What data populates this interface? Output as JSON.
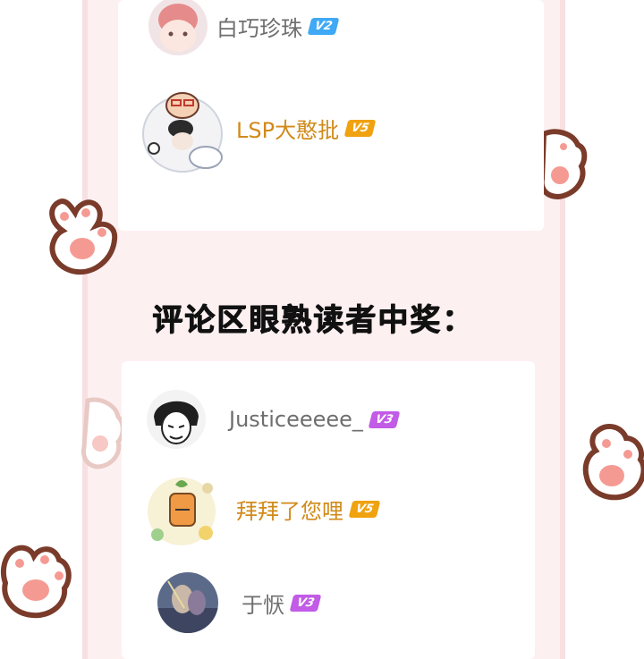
{
  "section_heading": "评论区眼熟读者中奖：",
  "top_users": [
    {
      "name": "白巧珍珠",
      "level": "V2"
    },
    {
      "name": "LSP大憨批",
      "level": "V5"
    }
  ],
  "winners": [
    {
      "name": "Justiceeeee_",
      "level": "V3"
    },
    {
      "name": "拜拜了您哩",
      "level": "V5"
    },
    {
      "name": "于恹",
      "level": "V3"
    }
  ],
  "colors": {
    "gold_name": "#d18a1a",
    "gray_name": "#6e6e6e",
    "badge_v2": "#3fa9f5",
    "badge_v3": "#c25be6",
    "badge_v5": "#f0a20f"
  }
}
